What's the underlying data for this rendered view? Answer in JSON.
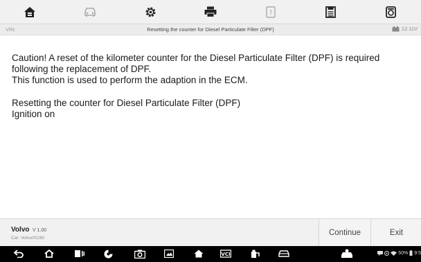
{
  "toolbar": {
    "icons": [
      "home-icon",
      "vehicle-swap-icon",
      "settings-icon",
      "print-icon",
      "help-icon",
      "save-icon",
      "data-logging-icon"
    ]
  },
  "titlebar": {
    "vin_label": "VIN:",
    "title": "Resetting the counter for Diesel Particulate Filter (DPF)",
    "voltage": "12.11V"
  },
  "content": {
    "caution_line": "Caution! A reset of the kilometer counter for the Diesel Particulate Filter (DPF) is required following the replacement of DPF.",
    "function_line": "This function is used to perform the adaption in the ECM.",
    "reset_line": "Resetting the counter for Diesel Particulate Filter (DPF)",
    "ignition_line": "Ignition on"
  },
  "footer": {
    "make": "Volvo",
    "version": "V 1.00",
    "car": "Car: Volvo/XC60",
    "continue_label": "Continue",
    "exit_label": "Exit"
  },
  "navbar": {
    "battery": "50%",
    "time": "9:5",
    "icons": [
      "back-icon",
      "home-nav-icon",
      "recent-apps-icon",
      "chrome-icon",
      "camera-icon",
      "screenshot-icon",
      "home-shortcut-icon",
      "vci-icon",
      "service-icon",
      "car-icon"
    ]
  },
  "colors": {
    "toolbar_bg": "#f1f1f1",
    "titlebar_bg": "#ececec",
    "footer_bg": "#f1f1f1",
    "navbar_bg": "#000000",
    "text": "#1a1a1a"
  }
}
